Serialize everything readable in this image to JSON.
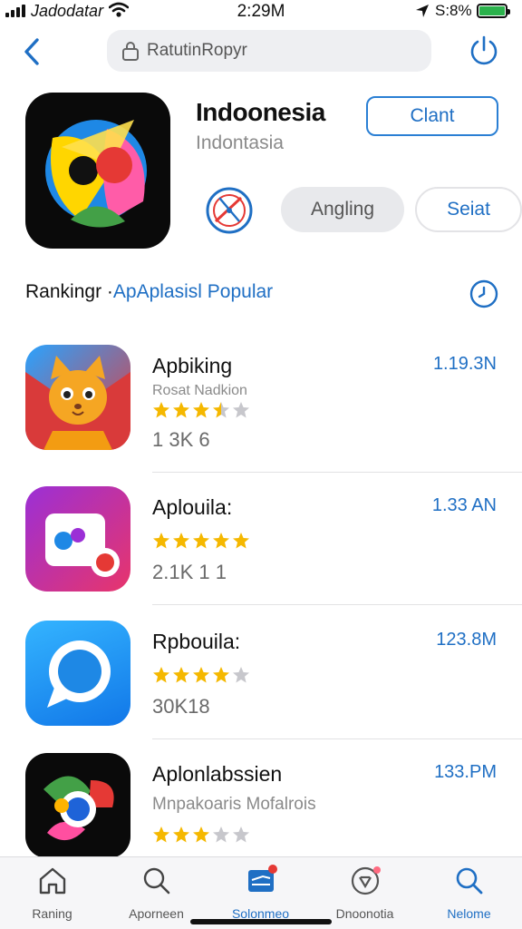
{
  "status_bar": {
    "carrier": "Jadodatar",
    "time": "2:29M",
    "battery_text": "S:8%"
  },
  "nav": {
    "search_text": "RatutinRopyr"
  },
  "app": {
    "title": "Indoonesia",
    "subtitle": "Indontasia",
    "primary_button": "Clant",
    "secondary_button_1": "Angling",
    "secondary_button_2": "Seiat"
  },
  "section": {
    "title_dark": "Ranking",
    "title_mid": "r ·",
    "title_blue": "ApAplasisl Popular"
  },
  "apps": [
    {
      "name": "Apbiking",
      "developer": "Rosat Nadkion",
      "size": "1.19.3N",
      "rating": 3.5,
      "count": "1 3K 6"
    },
    {
      "name": "Aplouila:",
      "developer": "",
      "size": "1.33 AN",
      "rating": 5,
      "count": "2.1K 1 1"
    },
    {
      "name": "Rpbouila:",
      "developer": "",
      "size": "123.8M",
      "rating": 4,
      "count": "30K18"
    },
    {
      "name": "Aplonlabssien",
      "developer": "Mnpakoaris Mofalrois",
      "size": "133.PM",
      "rating": 3,
      "count": ""
    }
  ],
  "tabs": [
    {
      "label": "Raning",
      "icon": "home-icon"
    },
    {
      "label": "Aporneen",
      "icon": "search-icon"
    },
    {
      "label": "Solonmeo",
      "icon": "apps-icon"
    },
    {
      "label": "Dnoonotia",
      "icon": "rocket-icon"
    },
    {
      "label": "Nelome",
      "icon": "search-icon"
    }
  ],
  "colors": {
    "accent": "#1f6fc4",
    "star": "#f5b800",
    "star_empty": "#c7c7cc",
    "battery": "#2bb24c"
  }
}
